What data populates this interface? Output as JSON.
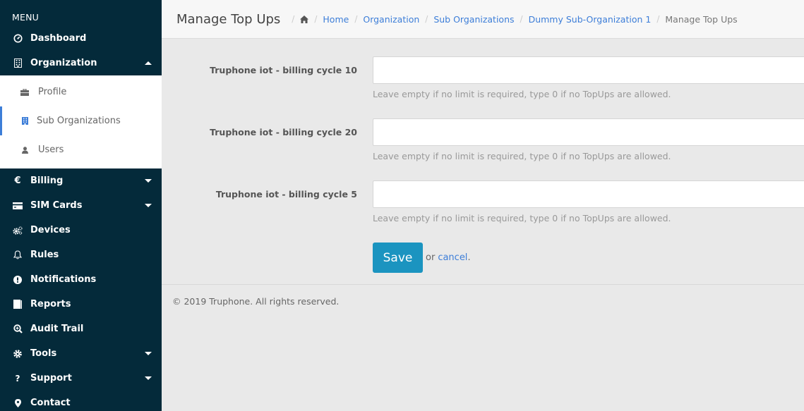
{
  "sidebar": {
    "menu_title": "MENU",
    "items": [
      {
        "label": "Dashboard",
        "icon": "dashboard-icon"
      },
      {
        "label": "Organization",
        "icon": "building-icon",
        "expanded": true
      },
      {
        "label": "Billing",
        "icon": "euro-icon",
        "has_submenu": true
      },
      {
        "label": "SIM Cards",
        "icon": "credit-card-icon",
        "has_submenu": true
      },
      {
        "label": "Devices",
        "icon": "gears-icon"
      },
      {
        "label": "Rules",
        "icon": "bell-icon"
      },
      {
        "label": "Notifications",
        "icon": "exclamation-circle-icon"
      },
      {
        "label": "Reports",
        "icon": "book-icon"
      },
      {
        "label": "Audit Trail",
        "icon": "search-plus-icon"
      },
      {
        "label": "Tools",
        "icon": "gear-icon",
        "has_submenu": true
      },
      {
        "label": "Support",
        "icon": "question-icon",
        "has_submenu": true
      },
      {
        "label": "Contact",
        "icon": "map-marker-icon"
      }
    ],
    "organization_submenu": [
      {
        "label": "Profile",
        "icon": "briefcase-icon"
      },
      {
        "label": "Sub Organizations",
        "icon": "building-icon",
        "active": true
      },
      {
        "label": "Users",
        "icon": "user-icon"
      }
    ]
  },
  "header": {
    "title": "Manage Top Ups",
    "breadcrumb": [
      {
        "label": "Home",
        "link": true
      },
      {
        "label": "Organization",
        "link": true
      },
      {
        "label": "Sub Organizations",
        "link": true
      },
      {
        "label": "Dummy Sub-Organization 1",
        "link": true
      },
      {
        "label": "Manage Top Ups",
        "link": false
      }
    ],
    "separator": "/"
  },
  "form": {
    "fields": [
      {
        "label": "Truphone iot - billing cycle 10",
        "value": "",
        "help": "Leave empty if no limit is required, type 0 if no TopUps are allowed."
      },
      {
        "label": "Truphone iot - billing cycle 20",
        "value": "",
        "help": "Leave empty if no limit is required, type 0 if no TopUps are allowed."
      },
      {
        "label": "Truphone iot - billing cycle 5",
        "value": "",
        "help": "Leave empty if no limit is required, type 0 if no TopUps are allowed."
      }
    ],
    "save_label": "Save",
    "or_text": "or",
    "cancel_label": "cancel",
    "period": "."
  },
  "footer": {
    "copyright": "© 2019 Truphone. All rights reserved."
  },
  "colors": {
    "sidebar_bg": "#042a3a",
    "accent": "#3d7ed8",
    "save_button": "#1b94c0",
    "content_bg": "#e9e9e9"
  }
}
